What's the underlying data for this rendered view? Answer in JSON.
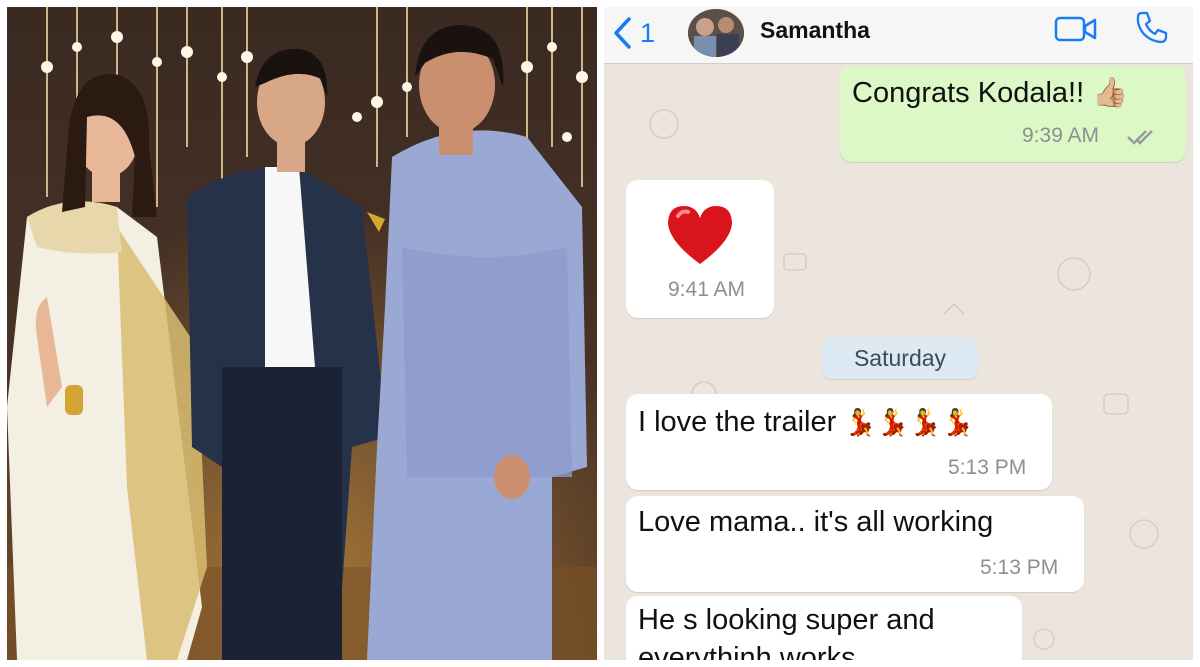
{
  "photo": {
    "description_icon": "engagement-photo-image"
  },
  "header": {
    "back_count": "1",
    "contact_name": "Samantha",
    "video_icon": "video-call-icon",
    "call_icon": "phone-icon",
    "accent_color": "#1a7cf5"
  },
  "messages": [
    {
      "direction": "outgoing",
      "text": "Congrats Kodala!!",
      "emoji": "thumbs-up",
      "time": "9:39 AM",
      "status": "read-double-check"
    },
    {
      "direction": "incoming",
      "text": "",
      "emoji": "red-heart",
      "time": "9:41 AM"
    },
    {
      "direction": "incoming",
      "text": "I love the trailer",
      "emoji": "dancer x4",
      "time": "5:13 PM"
    },
    {
      "direction": "incoming",
      "text": "Love mama.. it's all working",
      "time": "5:13 PM"
    },
    {
      "direction": "incoming",
      "text_line1": "He s looking super and",
      "text_line2": "everythinh works"
    }
  ],
  "date_divider": "Saturday",
  "colors": {
    "outgoing_bubble": "#dcf8c6",
    "incoming_bubble": "#ffffff",
    "wallpaper": "#ece5dd"
  }
}
